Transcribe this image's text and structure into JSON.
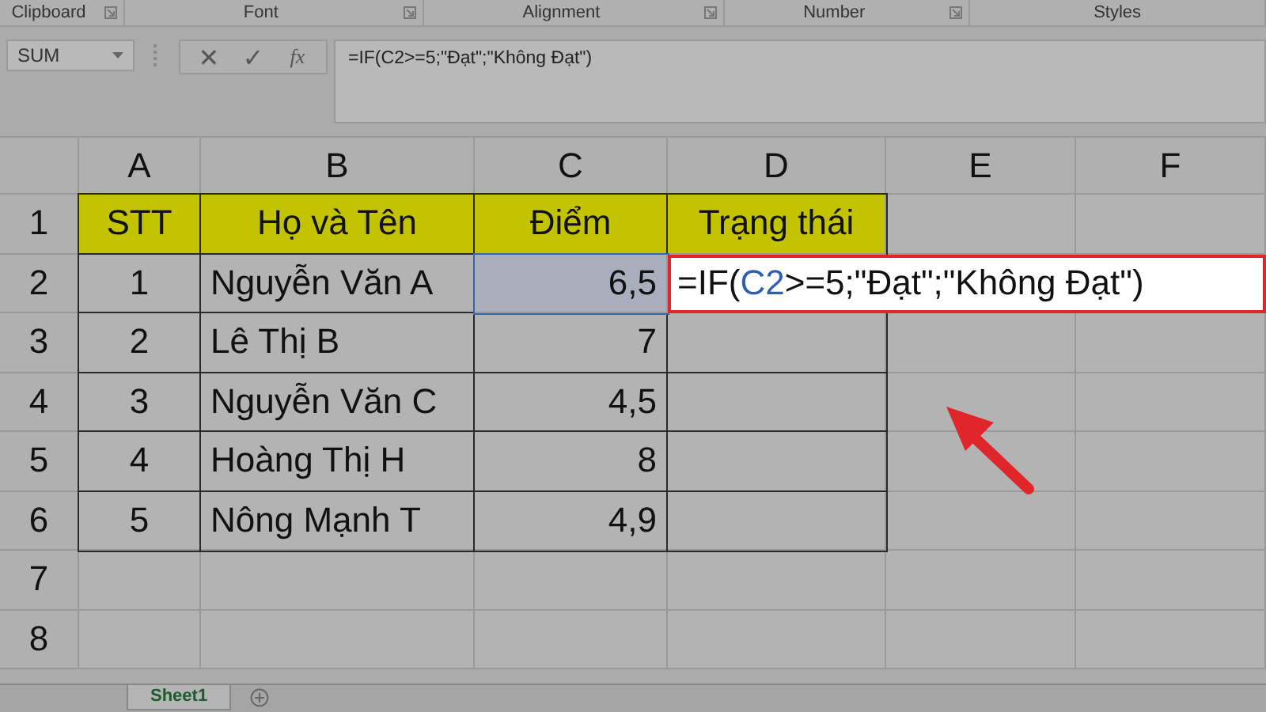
{
  "ribbon_groups": [
    {
      "label": "Clipboard",
      "launcher": true
    },
    {
      "label": "Font",
      "launcher": true
    },
    {
      "label": "Alignment",
      "launcher": true
    },
    {
      "label": "Number",
      "launcher": true
    },
    {
      "label": "Styles",
      "launcher": false
    }
  ],
  "name_box": {
    "value": "SUM"
  },
  "formula_bar": {
    "cancel": "✕",
    "enter": "✓",
    "function": "fx",
    "formula": "=IF(C2>=5;\"Đạt\";\"Không Đạt\")"
  },
  "columns": [
    "A",
    "B",
    "C",
    "D",
    "E",
    "F"
  ],
  "rows": [
    {
      "header": "1",
      "cells": [
        {
          "kind": "title",
          "text": "STT",
          "selected": false
        },
        {
          "kind": "title",
          "text": "Họ và Tên",
          "selected": false
        },
        {
          "kind": "title",
          "text": "Điểm",
          "selected": false
        },
        {
          "kind": "title",
          "text": "Trạng thái",
          "selected": false
        }
      ]
    },
    {
      "header": "2",
      "cells": [
        {
          "kind": "index",
          "text": "1",
          "selected": false
        },
        {
          "kind": "name",
          "text": "Nguyễn Văn A",
          "selected": false
        },
        {
          "kind": "score",
          "text": "6,5",
          "selected": true
        },
        {
          "kind": "editing",
          "selected": false,
          "parts": [
            {
              "text": "=IF(",
              "ref": false
            },
            {
              "text": "C2",
              "ref": true
            },
            {
              "text": ">=5;\"Đạt\";\"Không Đạt\")",
              "ref": false
            }
          ]
        }
      ]
    },
    {
      "header": "3",
      "cells": [
        {
          "kind": "index",
          "text": "2",
          "selected": false
        },
        {
          "kind": "name",
          "text": "Lê Thị B",
          "selected": false
        },
        {
          "kind": "score",
          "text": "7",
          "selected": false
        },
        {
          "kind": "blank",
          "selected": false
        }
      ]
    },
    {
      "header": "4",
      "cells": [
        {
          "kind": "index",
          "text": "3",
          "selected": false
        },
        {
          "kind": "name",
          "text": "Nguyễn Văn C",
          "selected": false
        },
        {
          "kind": "score",
          "text": "4,5",
          "selected": false
        },
        {
          "kind": "blank",
          "selected": false
        }
      ]
    },
    {
      "header": "5",
      "cells": [
        {
          "kind": "index",
          "text": "4",
          "selected": false
        },
        {
          "kind": "name",
          "text": "Hoàng Thị H",
          "selected": false
        },
        {
          "kind": "score",
          "text": "8",
          "selected": false
        },
        {
          "kind": "blank",
          "selected": false
        }
      ]
    },
    {
      "header": "6",
      "cells": [
        {
          "kind": "index",
          "text": "5",
          "selected": false
        },
        {
          "kind": "name",
          "text": "Nông Mạnh T",
          "selected": false
        },
        {
          "kind": "score",
          "text": "4,9",
          "selected": false
        },
        {
          "kind": "blank",
          "selected": false
        }
      ]
    },
    {
      "header": "7",
      "cells": []
    },
    {
      "header": "8",
      "cells": []
    }
  ],
  "sheet_tabs": [
    {
      "label": "Sheet1",
      "selected": true
    }
  ]
}
